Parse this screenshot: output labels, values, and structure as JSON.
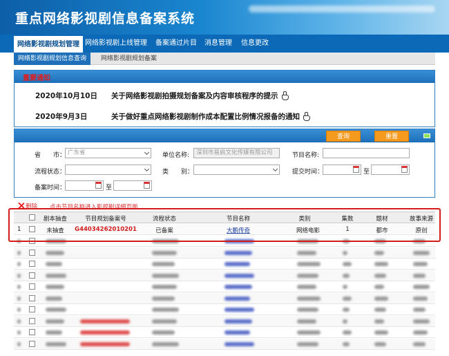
{
  "header": {
    "title": "重点网络影视剧信息备案系统"
  },
  "nav": {
    "items": [
      {
        "label": "网络影视剧规划管理"
      },
      {
        "label": "网络影视剧上线管理"
      },
      {
        "label": "备案通过片目"
      },
      {
        "label": "消息管理"
      },
      {
        "label": "信息更改"
      }
    ]
  },
  "subnav": {
    "items": [
      {
        "label": "网络影视剧规划信息查询"
      },
      {
        "label": "网络影视剧规划备案"
      }
    ]
  },
  "notice": {
    "title": "重要通知",
    "items": [
      {
        "date": "2020年10月10日",
        "text": "关于网络影视剧拍摄规划备案及内容审核程序的提示"
      },
      {
        "date": "2020年9月3日",
        "text": "关于做好重点网络影视剧制作成本配置比例情况报备的通知"
      }
    ]
  },
  "search": {
    "query_label": "查询",
    "reset_label": "重置",
    "province_label": "省　　市：",
    "province_value": "广东省",
    "unit_label": "单位名称:",
    "unit_value": "深圳市易启文化传媒有限公司",
    "program_label": "节目名称:",
    "process_label": "流程状态：",
    "category_label": "类　　别：",
    "submit_time_label": "提交时间：",
    "record_time_label": "备案时间：",
    "to_label": "至"
  },
  "actions": {
    "delete_label": "删除",
    "hint": "点击节目名称进入影视剧详细页面"
  },
  "table": {
    "headers": [
      "剧本抽查",
      "节目规划备案号",
      "流程状态",
      "节目名称",
      "类别",
      "集数",
      "题材",
      "故事来源"
    ],
    "rows": [
      {
        "index": "1",
        "spot_check": "未抽查",
        "record_no": "G44034262010201",
        "status": "已备案",
        "name": "大鹏传奇",
        "category": "网络电影",
        "episodes": "1",
        "subject": "都市",
        "source": "原创"
      }
    ]
  },
  "colors": {
    "header_blue": "#0b69b7",
    "accent_red": "#d31c1c",
    "button_orange": "#f39a1f",
    "link_blue": "#1b3c9e"
  }
}
